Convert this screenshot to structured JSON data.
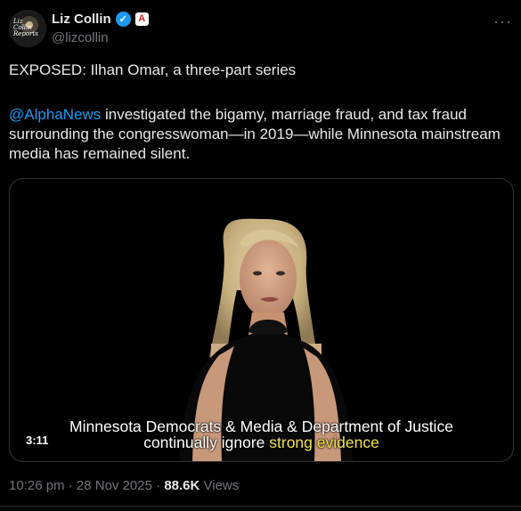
{
  "author": {
    "display_name": "Liz Collin",
    "handle": "@lizcollin",
    "avatar_text": "Liz Collin Reports",
    "verified_icon": "verified-badge-icon",
    "affiliate_icon": "affiliate-badge-icon",
    "affiliate_letter": "A"
  },
  "tweet": {
    "line1": "EXPOSED: Ilhan Omar, a three-part series",
    "mention": "@AlphaNews",
    "line2_rest": " investigated the bigamy, marriage fraud, and tax fraud surrounding the congresswoman—in 2019—while Minnesota mainstream media has remained silent."
  },
  "video": {
    "duration": "3:11",
    "caption_line1": "Minnesota Democrats & Media & Department of Justice",
    "caption_line2_prefix": "continually ignore ",
    "caption_line2_highlight": "strong evidence"
  },
  "meta": {
    "time": "10:26 pm",
    "sep1": " · ",
    "date": "28 Nov 2025",
    "sep2": " · ",
    "views_count": "88.6K",
    "views_label": " Views"
  },
  "colors": {
    "background": "#000000",
    "text": "#e7e9ea",
    "muted": "#71767b",
    "link": "#1d9bf0",
    "caption_highlight": "#f1e24a"
  }
}
